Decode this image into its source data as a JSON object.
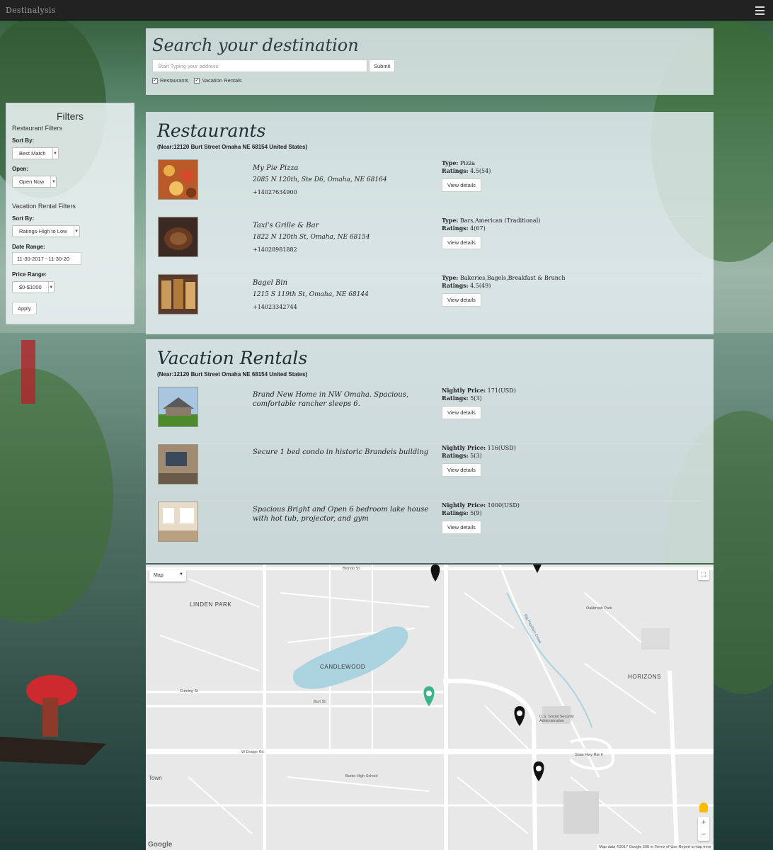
{
  "app": {
    "brand": "Destinalysis"
  },
  "search": {
    "title": "Search your destination",
    "placeholder": "Start Typing your address",
    "submit_label": "Submit",
    "checks": [
      {
        "label": "Restaurants",
        "checked": true
      },
      {
        "label": "Vacation Rentals",
        "checked": true
      }
    ]
  },
  "filters": {
    "title": "Filters",
    "restaurant_heading": "Restaurant Filters",
    "sort_label": "Sort By:",
    "sort_value": "Best Match",
    "open_label": "Open:",
    "open_value": "Open Now",
    "vacation_heading": "Vacation Rental Filters",
    "vac_sort_label": "Sort By:",
    "vac_sort_value": "Ratings-High to Low",
    "date_label": "Date Range:",
    "date_value": "11-30-2017 - 11-30-20",
    "price_label": "Price Range:",
    "price_value": "$0-$1000",
    "apply_label": "Apply"
  },
  "restaurants": {
    "title": "Restaurants",
    "near": "(Near:12120 Burt Street Omaha NE 68154 United States)",
    "details_label": "View details",
    "items": [
      {
        "name": "My Pie Pizza",
        "address": "2085 N 120th, Ste D6, Omaha, NE 68164",
        "phone": "+14027634900",
        "type_label": "Type:",
        "type": "Pizza",
        "ratings_label": "Ratings:",
        "ratings": "4.5(54)"
      },
      {
        "name": "Taxi's Grille & Bar",
        "address": "1822 N 120th St, Omaha, NE 68154",
        "phone": "+14028981882",
        "type_label": "Type:",
        "type": "Bars,American (Traditional)",
        "ratings_label": "Ratings:",
        "ratings": "4(67)"
      },
      {
        "name": "Bagel Bin",
        "address": "1215 S 119th St, Omaha, NE 68144",
        "phone": "+14023342744",
        "type_label": "Type:",
        "type": "Bakeries,Bagels,Breakfast & Brunch",
        "ratings_label": "Ratings:",
        "ratings": "4.5(49)"
      }
    ]
  },
  "rentals": {
    "title": "Vacation Rentals",
    "near": "(Near:12120 Burt Street Omaha NE 68154 United States)",
    "details_label": "View details",
    "items": [
      {
        "name": "Brand New Home in NW Omaha. Spacious, comfortable rancher sleeps 6.",
        "price_label": "Nightly Price:",
        "price": "171(USD)",
        "ratings_label": "Ratings:",
        "ratings": "5(3)"
      },
      {
        "name": "Secure 1 bed condo in historic Brandeis building",
        "price_label": "Nightly Price:",
        "price": "116(USD)",
        "ratings_label": "Ratings:",
        "ratings": "5(3)"
      },
      {
        "name": "Spacious Bright and Open 6 bedroom lake house with hot tub, projector, and gym",
        "price_label": "Nightly Price:",
        "price": "1000(USD)",
        "ratings_label": "Ratings:",
        "ratings": "5(9)"
      }
    ]
  },
  "map": {
    "type_label": "Map",
    "google": "Google",
    "footer": "Map data ©2017 Google   200 m   Terms of Use   Report a map error",
    "labels": {
      "linden_park": "LINDEN PARK",
      "candlewood": "CANDLEWOOD",
      "horizons": "HORIZONS",
      "oakbrook": "Oakbrook Park",
      "us_ssa": "U.S. Social Security Administration",
      "burke": "Burke High School",
      "dodge": "W Dodge Rd",
      "hwy6": "State Hwy Rte 6",
      "blondo": "Blondo St",
      "burt": "Burt St",
      "cuming": "Cuming St",
      "town": "Town",
      "pacific": "Big Papillion Creek"
    }
  },
  "colors": {
    "topbar": "#222222",
    "panel": "#e7eff1",
    "marker_green": "#3cb58a"
  }
}
